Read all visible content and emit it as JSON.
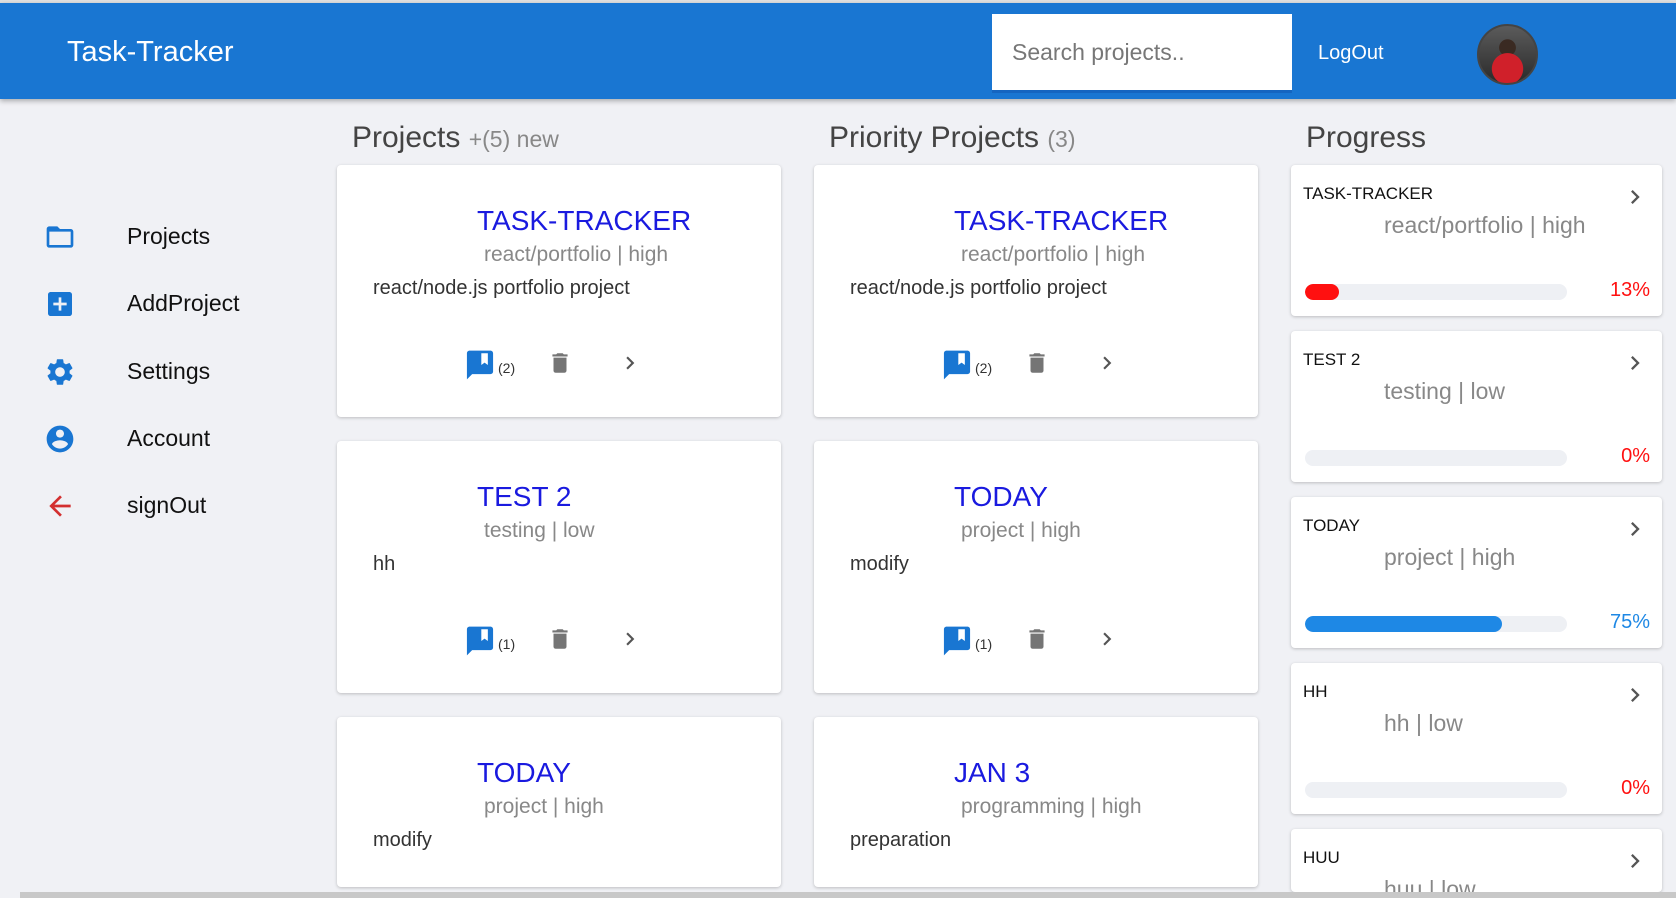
{
  "header": {
    "app_title": "Task-Tracker",
    "search_placeholder": "Search projects..",
    "logout_label": "LogOut"
  },
  "sidebar": {
    "items": [
      {
        "label": "Projects",
        "icon": "folder-icon"
      },
      {
        "label": "AddProject",
        "icon": "add-box-icon"
      },
      {
        "label": "Settings",
        "icon": "gear-icon"
      },
      {
        "label": "Account",
        "icon": "account-circle-icon"
      },
      {
        "label": "signOut",
        "icon": "arrow-left-icon"
      }
    ]
  },
  "projects_section": {
    "title": "Projects",
    "subtitle": "+(5) new",
    "cards": [
      {
        "title": "TASK-TRACKER",
        "meta": "react/portfolio | high",
        "desc": "react/node.js portfolio project",
        "notes": "(2)"
      },
      {
        "title": "TEST 2",
        "meta": "testing | low",
        "desc": "hh",
        "notes": "(1)"
      },
      {
        "title": "TODAY",
        "meta": "project | high",
        "desc": "modify",
        "notes": ""
      }
    ]
  },
  "priority_section": {
    "title": "Priority Projects",
    "subtitle": "(3)",
    "cards": [
      {
        "title": "TASK-TRACKER",
        "meta": "react/portfolio | high",
        "desc": "react/node.js portfolio project",
        "notes": "(2)"
      },
      {
        "title": "TODAY",
        "meta": "project | high",
        "desc": "modify",
        "notes": "(1)"
      },
      {
        "title": "JAN 3",
        "meta": "programming | high",
        "desc": "preparation",
        "notes": ""
      }
    ]
  },
  "progress_section": {
    "title": "Progress",
    "items": [
      {
        "name": "TASK-TRACKER",
        "meta": "react/portfolio | high",
        "percent_label": "13%",
        "fraction": 0.13,
        "color": "#ff1010"
      },
      {
        "name": "TEST 2",
        "meta": "testing | low",
        "percent_label": "0%",
        "fraction": 0,
        "color": "#ff1010"
      },
      {
        "name": "TODAY",
        "meta": "project | high",
        "percent_label": "75%",
        "fraction": 0.75,
        "color": "#1e88e5"
      },
      {
        "name": "HH",
        "meta": "hh | low",
        "percent_label": "0%",
        "fraction": 0,
        "color": "#ff1010"
      },
      {
        "name": "HUU",
        "meta": "huu | low",
        "percent_label": "",
        "fraction": 0,
        "color": "#ff1010"
      }
    ]
  },
  "colors": {
    "appbar": "#1976d2",
    "card_title": "#1a1adf",
    "icon_blue": "#1976d2",
    "icon_grey": "#757575",
    "signout_red": "#d32f2f"
  }
}
